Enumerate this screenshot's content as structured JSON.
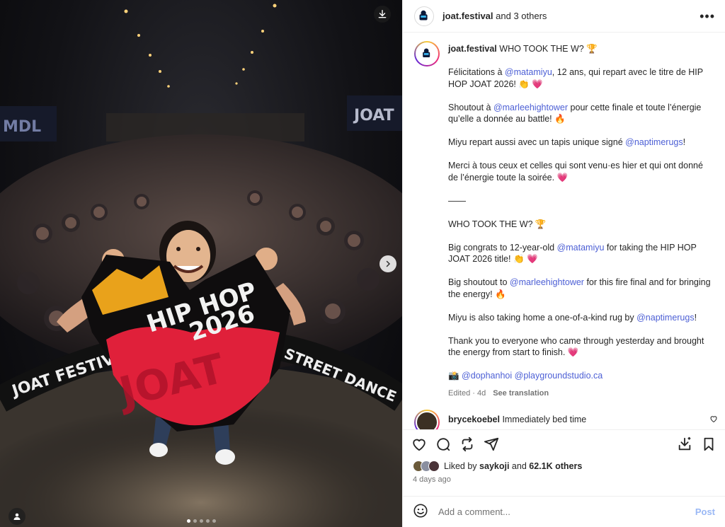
{
  "photo": {
    "banner_left": "JOAT  FESTIVAL",
    "banner_right": "STREET  DANCE",
    "rug_line1": "HIP HOP",
    "rug_line2": "2026",
    "rug_big": "JOAT",
    "sign_left": "MDL",
    "sign_right": "JOAT",
    "dot_count": 5,
    "active_dot": 0
  },
  "header": {
    "username": "joat.festival",
    "collab_text": "and 3 others",
    "more_label": "•••"
  },
  "post": {
    "username": "joat.festival",
    "title": "WHO TOOK THE W? 🏆",
    "paragraphs": [
      [
        {
          "t": "Félicitations à "
        },
        {
          "m": "@matamiyu"
        },
        {
          "t": ", 12 ans, qui repart avec le titre de HIP HOP JOAT 2026! 👏 💗"
        }
      ],
      [
        {
          "t": "Shoutout à "
        },
        {
          "m": "@marleehightower"
        },
        {
          "t": " pour cette finale et toute l’énergie qu’elle a donnée au battle! 🔥"
        }
      ],
      [
        {
          "t": "Miyu repart aussi avec un tapis unique signé "
        },
        {
          "m": "@naptimerugs"
        },
        {
          "t": "!"
        }
      ],
      [
        {
          "t": "Merci à tous ceux et celles qui sont venu·es hier et qui ont donné de l’énergie toute la soirée. 💗"
        }
      ],
      [
        {
          "t": "——"
        }
      ],
      [
        {
          "t": "WHO TOOK THE W? 🏆"
        }
      ],
      [
        {
          "t": "Big congrats to 12-year-old "
        },
        {
          "m": "@matamiyu"
        },
        {
          "t": " for taking the HIP HOP JOAT 2026 title! 👏 💗"
        }
      ],
      [
        {
          "t": "Big shoutout to "
        },
        {
          "m": "@marleehightower"
        },
        {
          "t": " for this fire final and for bringing the energy! 🔥"
        }
      ],
      [
        {
          "t": "Miyu is also taking home a one-of-a-kind rug by "
        },
        {
          "m": "@naptimerugs"
        },
        {
          "t": "!"
        }
      ],
      [
        {
          "t": "Thank you to everyone who came through yesterday and brought the energy from start to finish. 💗"
        }
      ],
      [
        {
          "t": "📸 "
        },
        {
          "m": "@dophanhoi"
        },
        {
          "t": " "
        },
        {
          "m": "@playgroundstudio.ca"
        }
      ]
    ],
    "edited": "Edited · 4d",
    "see_translation": "See translation"
  },
  "comment": {
    "username": "brycekoebel",
    "text": "Immediately bed time"
  },
  "actions": {
    "icons": [
      "heart-icon",
      "comment-icon",
      "repost-icon",
      "share-icon",
      "save-to-collection-icon",
      "bookmark-icon"
    ]
  },
  "likes": {
    "prefix": "Liked by",
    "user": "saykoji",
    "middle": "and",
    "count": "62.1K others"
  },
  "timestamp": "4 days ago",
  "add_comment": {
    "placeholder": "Add a comment...",
    "post_label": "Post"
  },
  "colors": {
    "mention": "#4c5fd5",
    "post_button": "#9ab8f5",
    "rug_red": "#e0203a",
    "rug_gold": "#e9a21b"
  }
}
